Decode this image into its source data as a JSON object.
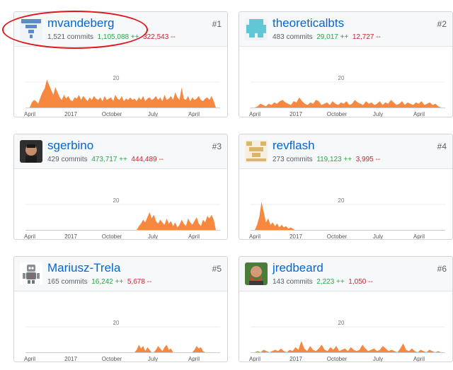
{
  "graph": {
    "y_tick": "20",
    "x_labels": [
      "April",
      "2017",
      "October",
      "July",
      "April"
    ],
    "area_color": "#f6893f"
  },
  "contributors": [
    {
      "username": "mvandeberg",
      "commits": "1,521 commits",
      "additions": "1,105,088 ++",
      "deletions": "322,543 --",
      "rank": "#1",
      "avatar": "identicon-blue",
      "avatar_color": "#5b8bc9",
      "highlighted": true,
      "series": [
        0,
        4,
        6,
        5,
        3,
        8,
        12,
        15,
        22,
        18,
        14,
        10,
        16,
        12,
        8,
        6,
        10,
        7,
        9,
        6,
        5,
        8,
        7,
        10,
        6,
        9,
        7,
        5,
        8,
        6,
        9,
        7,
        6,
        8,
        5,
        9,
        6,
        7,
        8,
        5,
        10,
        7,
        6,
        9,
        5,
        7,
        6,
        8,
        6,
        7,
        5,
        8,
        6,
        9,
        5,
        7,
        8,
        6,
        7,
        9,
        6,
        8,
        5,
        10,
        6,
        7,
        9,
        6,
        12,
        8,
        6,
        16,
        7,
        6,
        9,
        5,
        8,
        6,
        7,
        9,
        6,
        5,
        7,
        8,
        6,
        9,
        5,
        0
      ]
    },
    {
      "username": "theoreticalbts",
      "commits": "483 commits",
      "additions": "29,017 ++",
      "deletions": "12,727 --",
      "rank": "#2",
      "avatar": "identicon-cyan",
      "avatar_color": "#62c7d4",
      "highlighted": false,
      "series": [
        0,
        1,
        3,
        2,
        1,
        3,
        2,
        4,
        3,
        5,
        6,
        4,
        3,
        2,
        5,
        4,
        8,
        5,
        3,
        2,
        4,
        3,
        6,
        5,
        2,
        3,
        4,
        2,
        5,
        3,
        2,
        4,
        3,
        5,
        2,
        3,
        6,
        4,
        3,
        2,
        5,
        3,
        4,
        2,
        3,
        5,
        2,
        4,
        3,
        6,
        4,
        2,
        3,
        5,
        2,
        4,
        3,
        2,
        4,
        3,
        5,
        2,
        3,
        4,
        2,
        3,
        1,
        0
      ]
    },
    {
      "username": "sgerbino",
      "commits": "429 commits",
      "additions": "473,717 ++",
      "deletions": "444,489 --",
      "rank": "#3",
      "avatar": "photo-sgerbino",
      "avatar_color": "#3c3c3c",
      "highlighted": false,
      "series": [
        0,
        0,
        0,
        0,
        0,
        0,
        0,
        0,
        0,
        0,
        0,
        0,
        0,
        0,
        0,
        0,
        0,
        0,
        0,
        0,
        0,
        0,
        0,
        0,
        0,
        0,
        0,
        0,
        0,
        0,
        0,
        0,
        0,
        0,
        0,
        0,
        0,
        0,
        0,
        0,
        0,
        0,
        0,
        0,
        0,
        0,
        0,
        0,
        0,
        0,
        0,
        3,
        5,
        8,
        6,
        10,
        14,
        9,
        12,
        7,
        5,
        8,
        6,
        4,
        9,
        5,
        7,
        3,
        6,
        2,
        4,
        8,
        5,
        3,
        9,
        6,
        4,
        7,
        10,
        5,
        3,
        8,
        6,
        11,
        9,
        12,
        8,
        0
      ]
    },
    {
      "username": "revflash",
      "commits": "273 commits",
      "additions": "119,123 ++",
      "deletions": "3,995 --",
      "rank": "#4",
      "avatar": "identicon-sand",
      "avatar_color": "#d9b56e",
      "highlighted": false,
      "series": [
        0,
        4,
        10,
        22,
        14,
        6,
        9,
        4,
        6,
        3,
        5,
        2,
        4,
        2,
        3,
        1,
        2,
        1,
        0
      ]
    },
    {
      "username": "Mariusz-Trela",
      "commits": "165 commits",
      "additions": "16,242 ++",
      "deletions": "5,678 --",
      "rank": "#5",
      "avatar": "robot-avatar",
      "avatar_color": "#8a8f95",
      "highlighted": false,
      "series": [
        0,
        0,
        0,
        0,
        0,
        0,
        0,
        0,
        0,
        0,
        0,
        0,
        0,
        0,
        0,
        0,
        0,
        0,
        0,
        0,
        0,
        0,
        0,
        0,
        0,
        0,
        0,
        0,
        0,
        0,
        0,
        0,
        0,
        0,
        0,
        0,
        0,
        0,
        0,
        0,
        0,
        0,
        0,
        0,
        0,
        0,
        0,
        0,
        0,
        0,
        2,
        6,
        3,
        5,
        1,
        4,
        2,
        0,
        0,
        2,
        5,
        3,
        1,
        4,
        6,
        2,
        3,
        0,
        0,
        0,
        0,
        0,
        0,
        0,
        0,
        0,
        0,
        2,
        5,
        3,
        4,
        1,
        0,
        0,
        0,
        0,
        0,
        0
      ]
    },
    {
      "username": "jredbeard",
      "commits": "143 commits",
      "additions": "2,223 ++",
      "deletions": "1,050 --",
      "rank": "#6",
      "avatar": "photo-jredbeard",
      "avatar_color": "#c9734e",
      "highlighted": false,
      "series": [
        0,
        1,
        0,
        2,
        1,
        0,
        1,
        2,
        1,
        3,
        1,
        0,
        2,
        1,
        4,
        2,
        9,
        3,
        1,
        5,
        2,
        1,
        3,
        6,
        2,
        1,
        4,
        2,
        5,
        1,
        2,
        3,
        1,
        4,
        2,
        1,
        2,
        6,
        3,
        1,
        2,
        3,
        1,
        2,
        5,
        3,
        1,
        2,
        1,
        0,
        3,
        7,
        2,
        1,
        3,
        1,
        0,
        2,
        1,
        0,
        2,
        1,
        0,
        1,
        0
      ]
    }
  ]
}
